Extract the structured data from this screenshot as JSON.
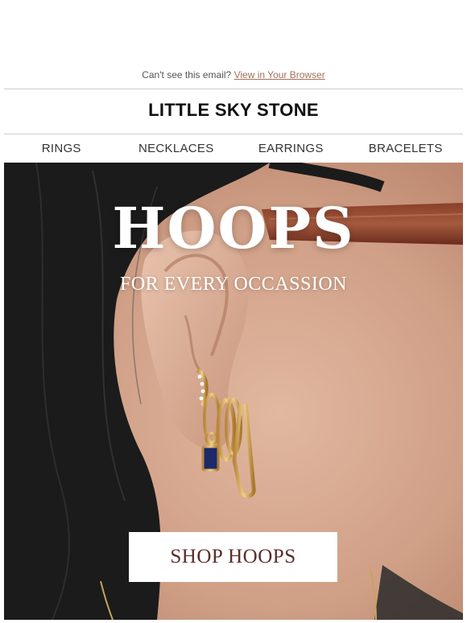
{
  "preheader": {
    "text": "Can't see this email?",
    "link_label": "View in Your Browser"
  },
  "brand": {
    "name": "LITTLE SKY STONE"
  },
  "nav": {
    "items": [
      {
        "label": "RINGS"
      },
      {
        "label": "NECKLACES"
      },
      {
        "label": "EARRINGS"
      },
      {
        "label": "BRACELETS"
      }
    ]
  },
  "hero": {
    "title": "HOOPS",
    "subtitle": "FOR EVERY OCCASSION",
    "cta_label": "SHOP HOOPS"
  },
  "colors": {
    "link": "#a0705a",
    "cta_text": "#5b2e2a",
    "skin": "#cc9f86",
    "hair": "#1b1b1b"
  }
}
